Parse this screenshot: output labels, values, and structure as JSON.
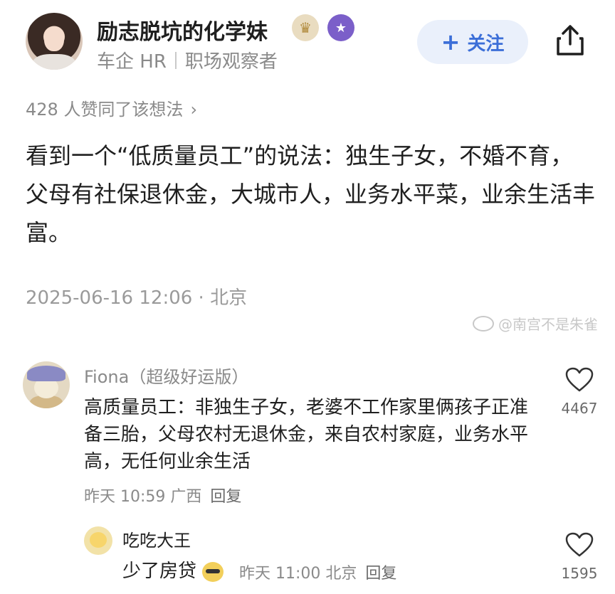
{
  "author": {
    "name": "励志脱坑的化学妹",
    "tag1": "车企 HR",
    "tag2": "职场观察者"
  },
  "header": {
    "follow_label": "关注",
    "follow_icon": "plus-icon",
    "share_icon": "share-icon"
  },
  "post": {
    "likes_text": "428 人赞同了该想法",
    "body": "看到一个“低质量员工”的说法：独生子女，不婚不育，父母有社保退休金，大城市人，业务水平菜，业余生活丰富。",
    "meta": "2025-06-16 12:06 · 北京"
  },
  "watermark": {
    "text": "@南宫不是朱雀"
  },
  "comments": [
    {
      "user": "Fiona（超级好运版）",
      "text": "高质量员工：非独生子女，老婆不工作家里俩孩子正准备三胎，父母农村无退休金，来自农村家庭，业务水平高，无任何业余生活",
      "time": "昨天 10:59 广西",
      "reply_label": "回复",
      "likes": "4467"
    },
    {
      "user": "吃吃大王",
      "text": "少了房贷",
      "time": "昨天 11:00 北京",
      "reply_label": "回复",
      "likes": "1595"
    }
  ],
  "colors": {
    "accent": "#3c6fd8",
    "follow_bg": "#eaf0fb",
    "muted": "#8a8a8a"
  }
}
